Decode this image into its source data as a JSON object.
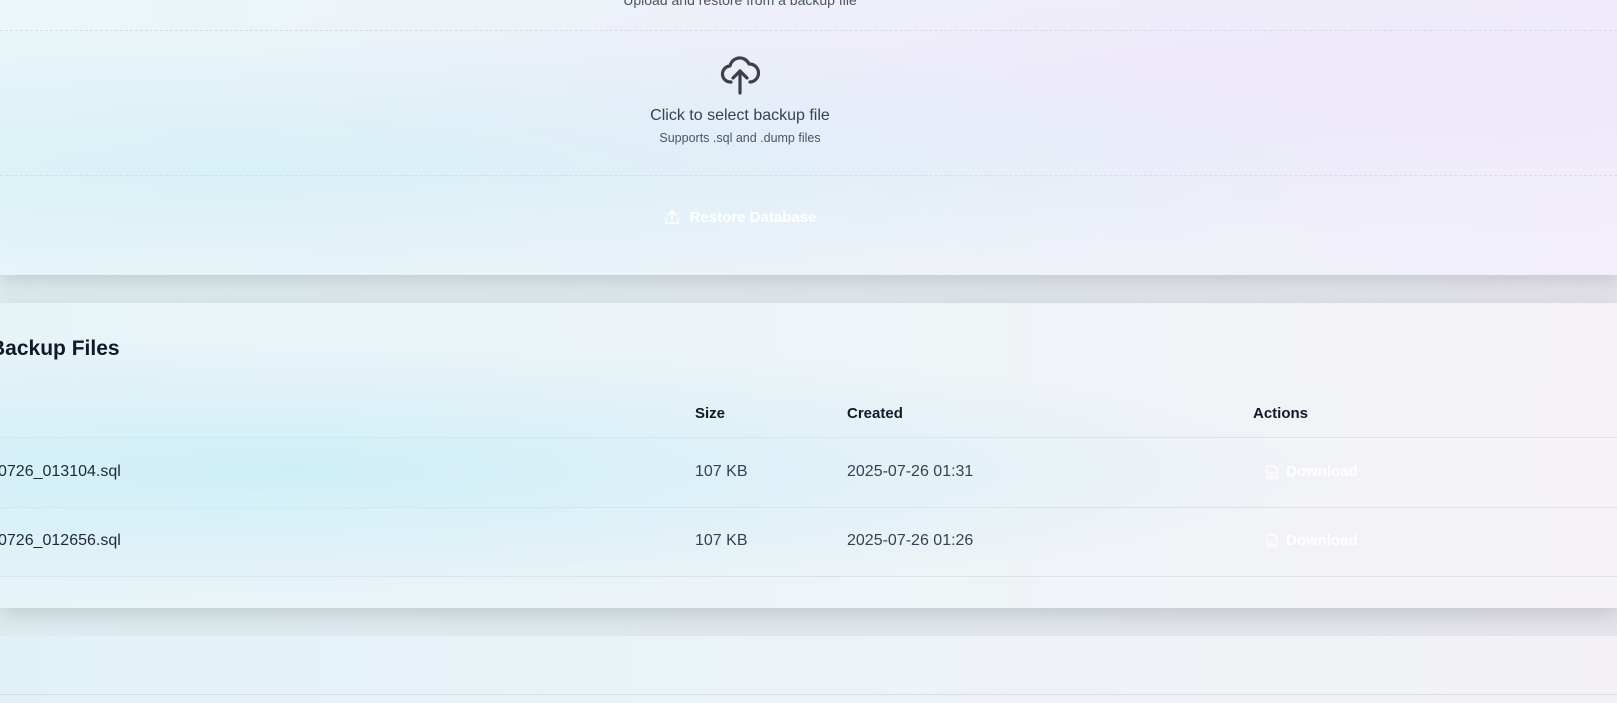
{
  "upload": {
    "subtitle": "Upload and restore from a backup file",
    "dropzone_title": "Click to select backup file",
    "dropzone_hint": "Supports .sql and .dump files",
    "restore_label": "Restore Database",
    "upload_icon": "cloud-upload-icon",
    "restore_icon": "upload-icon"
  },
  "backups": {
    "title": "Backup Files",
    "columns": {
      "size": "Size",
      "created": "Created",
      "actions": "Actions"
    },
    "rows": [
      {
        "filename": "0726_013104.sql",
        "size": "107 KB",
        "created": "2025-07-26 01:31",
        "action": "Download"
      },
      {
        "filename": "0726_012656.sql",
        "size": "107 KB",
        "created": "2025-07-26 01:26",
        "action": "Download"
      }
    ],
    "download_icon": "file-icon"
  }
}
